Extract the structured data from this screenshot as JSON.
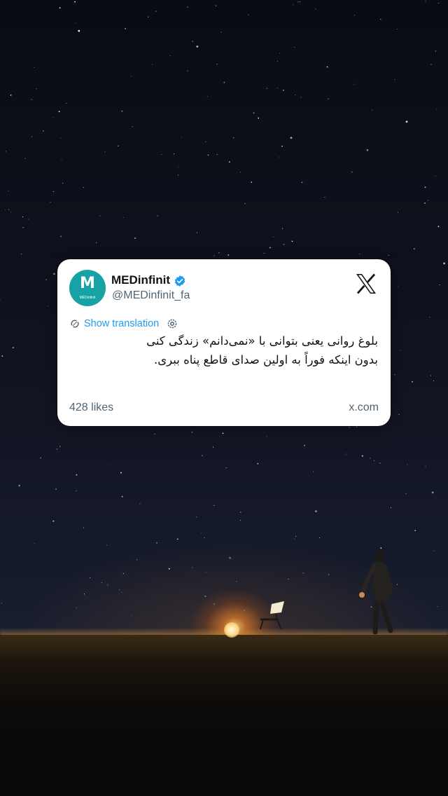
{
  "post": {
    "display_name": "MEDinfinit",
    "handle": "@MEDinfinit_fa",
    "avatar_text": "M",
    "avatar_subtext": "MEDinfinit",
    "verified_icon": "verified-badge-icon",
    "platform_logo": "x-logo-icon",
    "translation_label": "Show translation",
    "text_line_1": "بلوغ روانی یعنی بتوانی با «نمی‌دانم» زندگی کنی",
    "text_line_2": "بدون اینکه فوراً به اولین صدای قاطع پناه ببری.",
    "likes": "428 likes",
    "source_domain": "x.com"
  },
  "colors": {
    "card_background": "#ffffff",
    "link_blue": "#1d9bf0",
    "verified_blue": "#1d9bf0",
    "avatar_teal": "#17a3a6",
    "muted_text": "#536471",
    "sky": "#10131f"
  }
}
